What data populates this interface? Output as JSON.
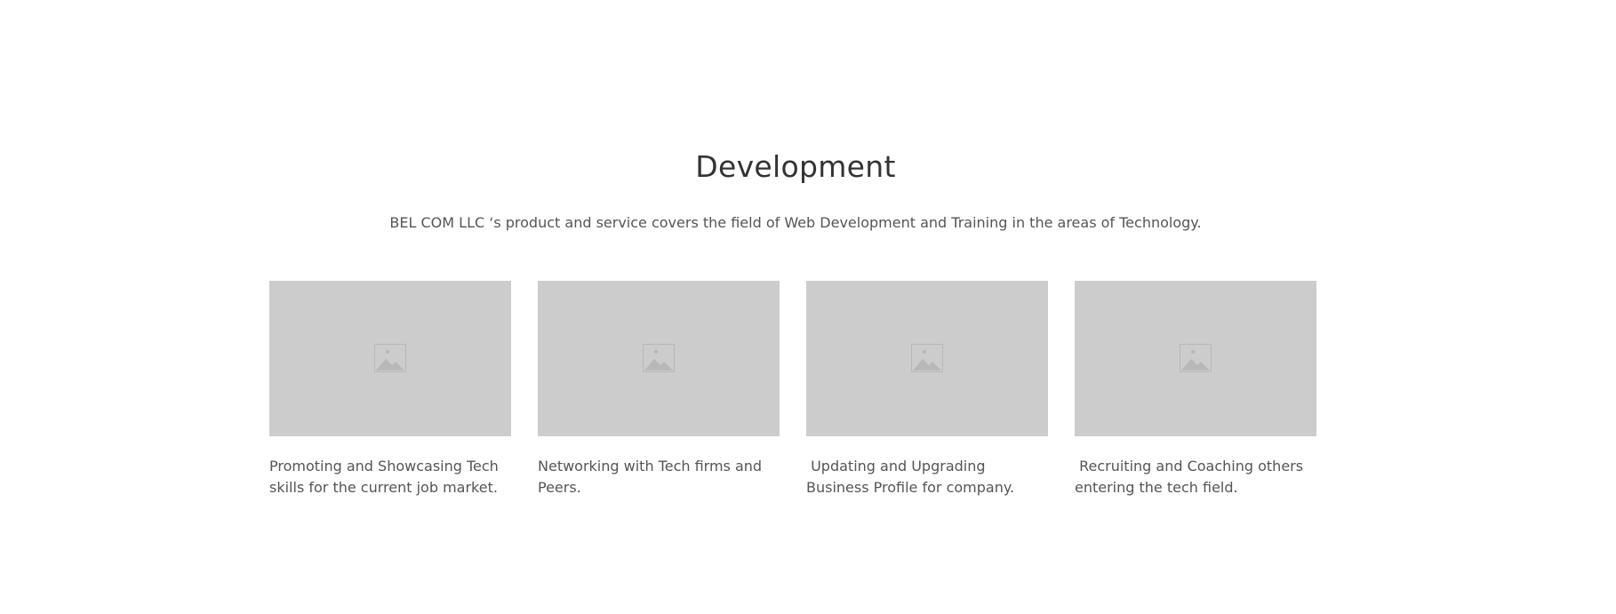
{
  "section": {
    "title": "Development",
    "subtitle": "BEL COM LLC ‘s product and service covers the field of Web Development and Training in the areas of Technology."
  },
  "cards": [
    {
      "icon": "image-placeholder-icon",
      "text": "Promoting and Showcasing Tech skills for the current job market."
    },
    {
      "icon": "image-placeholder-icon",
      "text": "Networking with Tech firms and Peers."
    },
    {
      "icon": "image-placeholder-icon",
      "text": " Updating and Upgrading Business Profile for company."
    },
    {
      "icon": "image-placeholder-icon",
      "text": " Recruiting and Coaching others entering the tech field."
    }
  ],
  "colors": {
    "background": "#ffffff",
    "placeholder": "#cccccc",
    "title": "#333333",
    "text": "#555555"
  }
}
